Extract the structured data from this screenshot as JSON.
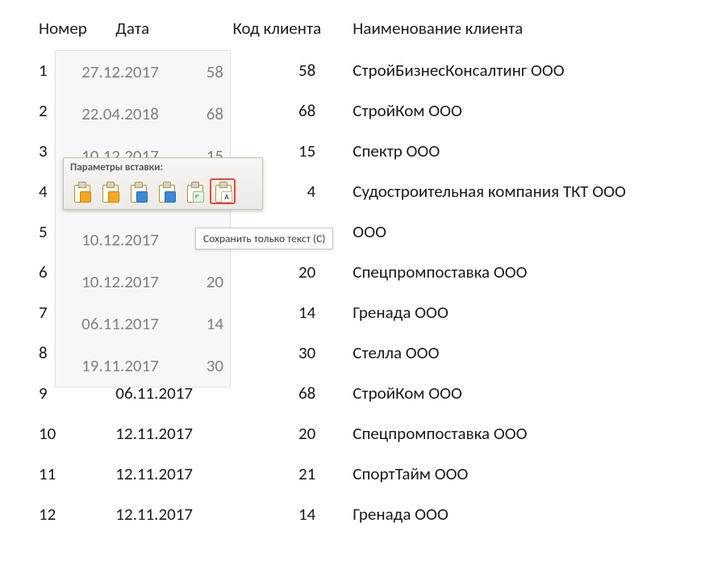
{
  "table": {
    "headers": {
      "num": "Номер",
      "date": "Дата",
      "code": "Код клиента",
      "name": "Наименование клиента"
    },
    "rows": [
      {
        "num": "1",
        "date": "27.12.2017",
        "code": "58",
        "name": "СтройБизнесКонсалтинг ООО"
      },
      {
        "num": "2",
        "date": "22.04.2018",
        "code": "68",
        "name": "СтройКом ООО"
      },
      {
        "num": "3",
        "date": "10.12.2017",
        "code": "15",
        "name": "Спектр ООО"
      },
      {
        "num": "4",
        "date": "",
        "code": "4",
        "name": "Судостроительная компания ТКТ ООО"
      },
      {
        "num": "5",
        "date": "10.12.2017",
        "code": "",
        "name": "ООО"
      },
      {
        "num": "6",
        "date": "10.12.2017",
        "code": "20",
        "name": "Спецпромпоставка ООО"
      },
      {
        "num": "7",
        "date": "06.11.2017",
        "code": "14",
        "name": "Гренада ООО"
      },
      {
        "num": "8",
        "date": "19.11.2017",
        "code": "30",
        "name": "Стелла ООО"
      },
      {
        "num": "9",
        "date": "06.11.2017",
        "code": "68",
        "name": "СтройКом ООО"
      },
      {
        "num": "10",
        "date": "12.11.2017",
        "code": "20",
        "name": "Спецпромпоставка ООО"
      },
      {
        "num": "11",
        "date": "12.11.2017",
        "code": "21",
        "name": "СпортТайм ООО"
      },
      {
        "num": "12",
        "date": "12.11.2017",
        "code": "14",
        "name": "Гренада ООО"
      }
    ]
  },
  "paste_options": {
    "title": "Параметры вставки:",
    "tooltip": "Сохранить только текст (С)",
    "options": [
      {
        "id": "keep-source",
        "badge_class": "orange",
        "badge_label": ""
      },
      {
        "id": "dest-style",
        "badge_class": "orange",
        "badge_label": ""
      },
      {
        "id": "merge-format",
        "badge_class": "blue",
        "badge_label": ""
      },
      {
        "id": "link-styles",
        "badge_class": "blue",
        "badge_label": ""
      },
      {
        "id": "picture",
        "badge_class": "img",
        "badge_label": ""
      },
      {
        "id": "text-only",
        "badge_class": "",
        "badge_label": "A",
        "selected": true
      }
    ]
  },
  "pasted_overlay": {
    "rows": [
      {
        "date": "27.12.2017",
        "code": "58"
      },
      {
        "date": "22.04.2018",
        "code": "68"
      },
      {
        "date": "10.12.2017",
        "code": "15"
      },
      {
        "date": "",
        "code": ""
      },
      {
        "date": "10.12.2017",
        "code": ""
      },
      {
        "date": "10.12.2017",
        "code": "20"
      },
      {
        "date": "06.11.2017",
        "code": "14"
      },
      {
        "date": "19.11.2017",
        "code": "30"
      }
    ]
  }
}
